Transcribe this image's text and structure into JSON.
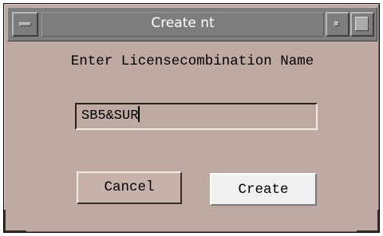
{
  "window": {
    "title": "Create nt"
  },
  "dialog": {
    "prompt": "Enter Licensecombination Name",
    "name_field": {
      "value": "SB5&SUR"
    },
    "buttons": {
      "cancel_label": "Cancel",
      "create_label": "Create"
    }
  },
  "colors": {
    "dialog_background": "#bfaaa3",
    "titlebar": "#7d7d7d",
    "title_text": "#ffffff",
    "create_button_background": "#f0f0f0"
  },
  "icons": {
    "window_menu": "window-menu-icon",
    "minimize": "minimize-icon",
    "maximize": "maximize-icon"
  }
}
